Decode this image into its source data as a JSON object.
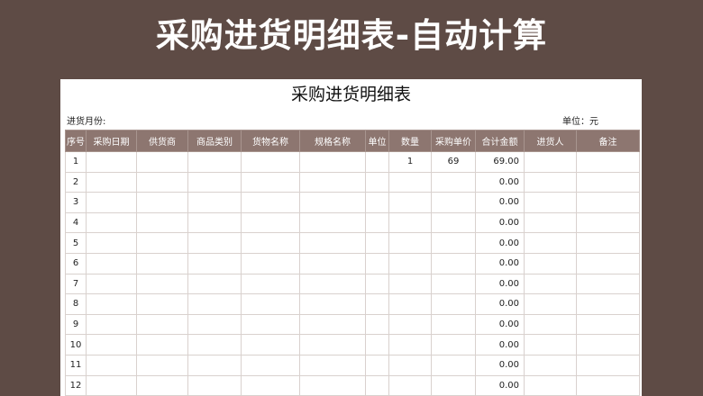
{
  "banner": {
    "title": "采购进货明细表-自动计算"
  },
  "sheet": {
    "title": "采购进货明细表",
    "month_label": "进货月份:",
    "unit_label": "单位：元"
  },
  "table": {
    "headers": [
      "序号",
      "采购日期",
      "供货商",
      "商品类别",
      "货物名称",
      "规格名称",
      "单位",
      "数量",
      "采购单价",
      "合计金额",
      "进货人",
      "备注"
    ],
    "rows": [
      {
        "no": "1",
        "date": "",
        "supplier": "",
        "category": "",
        "goods": "",
        "spec": "",
        "unit": "",
        "qty": "1",
        "price": "69",
        "total": "69.00",
        "buyer": "",
        "note": ""
      },
      {
        "no": "2",
        "date": "",
        "supplier": "",
        "category": "",
        "goods": "",
        "spec": "",
        "unit": "",
        "qty": "",
        "price": "",
        "total": "0.00",
        "buyer": "",
        "note": ""
      },
      {
        "no": "3",
        "date": "",
        "supplier": "",
        "category": "",
        "goods": "",
        "spec": "",
        "unit": "",
        "qty": "",
        "price": "",
        "total": "0.00",
        "buyer": "",
        "note": ""
      },
      {
        "no": "4",
        "date": "",
        "supplier": "",
        "category": "",
        "goods": "",
        "spec": "",
        "unit": "",
        "qty": "",
        "price": "",
        "total": "0.00",
        "buyer": "",
        "note": ""
      },
      {
        "no": "5",
        "date": "",
        "supplier": "",
        "category": "",
        "goods": "",
        "spec": "",
        "unit": "",
        "qty": "",
        "price": "",
        "total": "0.00",
        "buyer": "",
        "note": ""
      },
      {
        "no": "6",
        "date": "",
        "supplier": "",
        "category": "",
        "goods": "",
        "spec": "",
        "unit": "",
        "qty": "",
        "price": "",
        "total": "0.00",
        "buyer": "",
        "note": ""
      },
      {
        "no": "7",
        "date": "",
        "supplier": "",
        "category": "",
        "goods": "",
        "spec": "",
        "unit": "",
        "qty": "",
        "price": "",
        "total": "0.00",
        "buyer": "",
        "note": ""
      },
      {
        "no": "8",
        "date": "",
        "supplier": "",
        "category": "",
        "goods": "",
        "spec": "",
        "unit": "",
        "qty": "",
        "price": "",
        "total": "0.00",
        "buyer": "",
        "note": ""
      },
      {
        "no": "9",
        "date": "",
        "supplier": "",
        "category": "",
        "goods": "",
        "spec": "",
        "unit": "",
        "qty": "",
        "price": "",
        "total": "0.00",
        "buyer": "",
        "note": ""
      },
      {
        "no": "10",
        "date": "",
        "supplier": "",
        "category": "",
        "goods": "",
        "spec": "",
        "unit": "",
        "qty": "",
        "price": "",
        "total": "0.00",
        "buyer": "",
        "note": ""
      },
      {
        "no": "11",
        "date": "",
        "supplier": "",
        "category": "",
        "goods": "",
        "spec": "",
        "unit": "",
        "qty": "",
        "price": "",
        "total": "0.00",
        "buyer": "",
        "note": ""
      },
      {
        "no": "12",
        "date": "",
        "supplier": "",
        "category": "",
        "goods": "",
        "spec": "",
        "unit": "",
        "qty": "",
        "price": "",
        "total": "0.00",
        "buyer": "",
        "note": ""
      }
    ]
  },
  "colors": {
    "background": "#5e4b45",
    "header_fill": "#8d7670",
    "sheet": "#ffffff"
  }
}
